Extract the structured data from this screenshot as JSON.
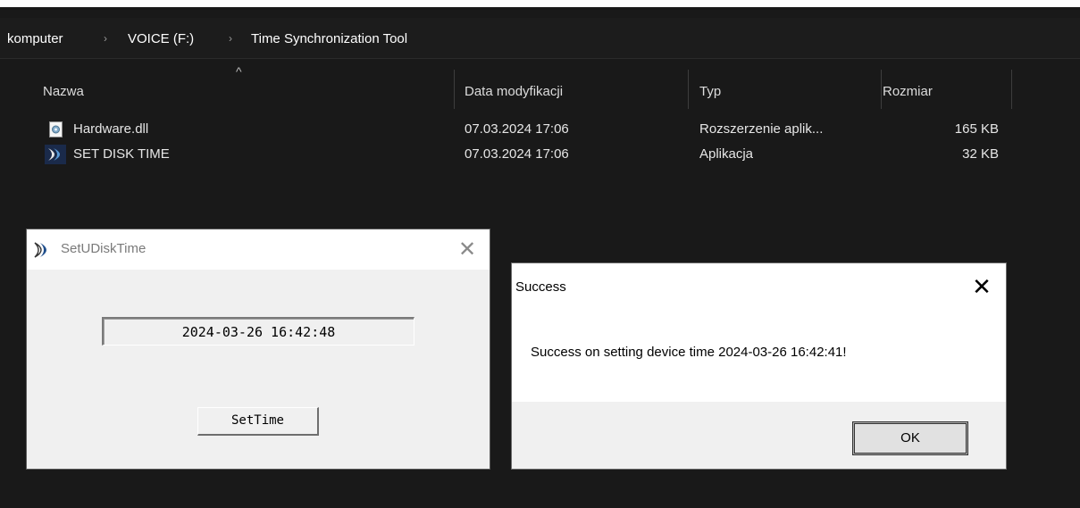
{
  "breadcrumb": {
    "items": [
      "komputer",
      "VOICE (F:)",
      "Time Synchronization Tool"
    ],
    "separator": "›"
  },
  "columns": {
    "name": "Nazwa",
    "modified": "Data modyfikacji",
    "type": "Typ",
    "size": "Rozmiar",
    "sort_indicator": "^"
  },
  "files": [
    {
      "name": "Hardware.dll",
      "modified": "07.03.2024 17:06",
      "type": "Rozszerzenie aplik...",
      "size": "165 KB",
      "icon": "dll-file-icon"
    },
    {
      "name": "SET DISK TIME",
      "modified": "07.03.2024 17:06",
      "type": "Aplikacja",
      "size": "32 KB",
      "icon": "app-exe-icon"
    }
  ],
  "setudisk_dialog": {
    "title": "SetUDiskTime",
    "time_value": "2024-03-26 16:42:48",
    "button_label": "SetTime",
    "close_glyph": "✕"
  },
  "success_dialog": {
    "title": "Success",
    "message": "Success on setting device time 2024-03-26 16:42:41!",
    "ok_label": "OK",
    "close_glyph": "✕"
  },
  "colors": {
    "explorer_bg": "#191919",
    "dialog_bg": "#f0f0f0",
    "text_light": "#e6e6e6"
  }
}
